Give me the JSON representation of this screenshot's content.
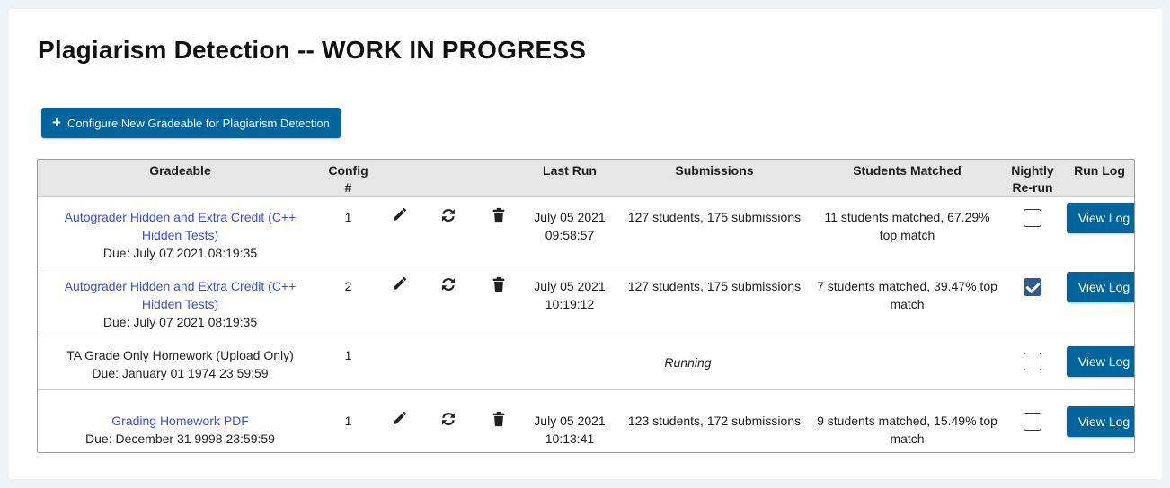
{
  "page": {
    "title": "Plagiarism Detection -- WORK IN PROGRESS",
    "configure_button_label": "Configure New Gradeable for Plagiarism Detection"
  },
  "table": {
    "headers": {
      "gradeable": "Gradeable",
      "config": "Config #",
      "last_run": "Last Run",
      "submissions": "Submissions",
      "students_matched": "Students Matched",
      "nightly_line1": "Nightly",
      "nightly_line2": "Re-run",
      "run_log": "Run Log"
    },
    "rows": [
      {
        "gradeable": "Autograder Hidden and Extra Credit (C++ Hidden Tests)",
        "is_link": true,
        "due": "Due: July 07 2021 08:19:35",
        "config": "1",
        "last_run_date": "July 05 2021",
        "last_run_time": "09:58:57",
        "submissions": "127 students, 175 submissions",
        "students_matched": "11 students matched, 67.29% top match",
        "nightly_rerun": false,
        "view_log_label": "View Log"
      },
      {
        "gradeable": "Autograder Hidden and Extra Credit (C++ Hidden Tests)",
        "is_link": true,
        "due": "Due: July 07 2021 08:19:35",
        "config": "2",
        "last_run_date": "July 05 2021",
        "last_run_time": "10:19:12",
        "submissions": "127 students, 175 submissions",
        "students_matched": "7 students matched, 39.47% top match",
        "nightly_rerun": true,
        "view_log_label": "View Log"
      },
      {
        "gradeable": "TA Grade Only Homework (Upload Only)",
        "is_link": false,
        "due": "Due: January 01 1974 23:59:59",
        "config": "1",
        "status": "Running",
        "nightly_rerun": false,
        "view_log_label": "View Log"
      },
      {
        "gradeable": "Grading Homework PDF",
        "is_link": true,
        "due": "Due: December 31 9998 23:59:59",
        "config": "1",
        "last_run_date": "July 05 2021",
        "last_run_time": "10:13:41",
        "submissions": "123 students, 172 submissions",
        "students_matched": "9 students matched, 15.49% top match",
        "nightly_rerun": false,
        "view_log_label": "View Log"
      }
    ]
  },
  "icons": {
    "add": "plus-icon",
    "edit": "pencil-icon",
    "rerun": "refresh-icon",
    "delete": "trash-icon"
  },
  "colors": {
    "primary_button": "#00659c",
    "link": "#3b4fd4",
    "header_bg": "#e6e6e6",
    "checkbox_checked": "#2f5a8a"
  }
}
